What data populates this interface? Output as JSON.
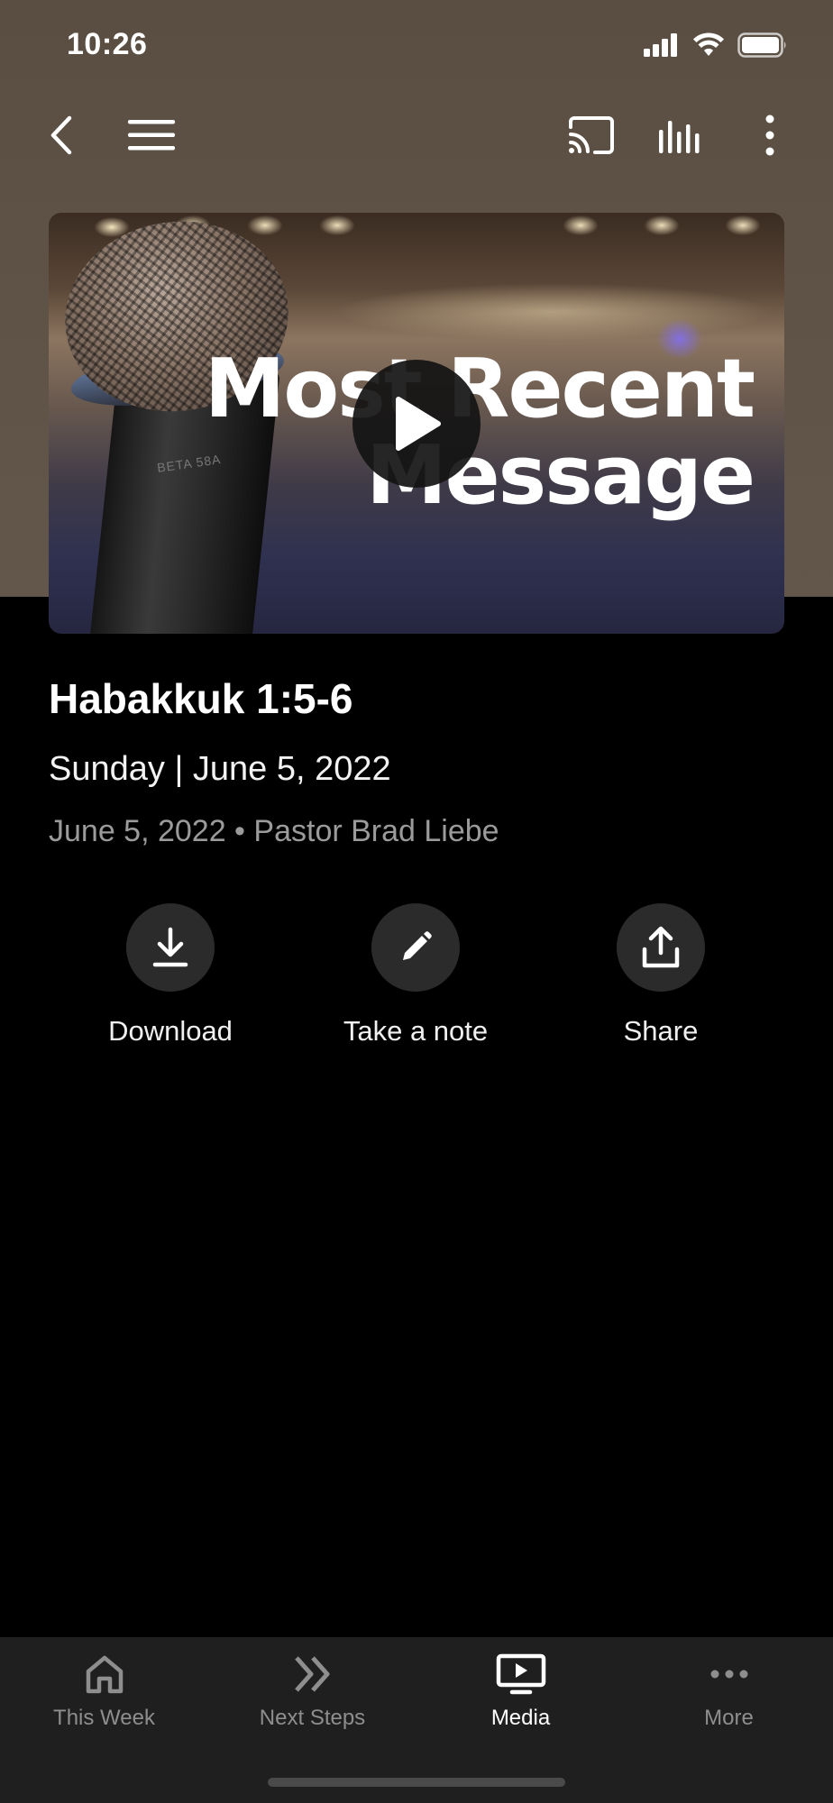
{
  "status_bar": {
    "time": "10:26"
  },
  "hero": {
    "title_line1": "Most Recent",
    "title_line2": "Message",
    "mic_text": "BETA 58A"
  },
  "message": {
    "title": "Habakkuk 1:5-6",
    "subtitle": "Sunday | June 5, 2022",
    "meta": "June 5, 2022 • Pastor Brad Liebe"
  },
  "actions": [
    {
      "label": "Download",
      "icon": "download-icon"
    },
    {
      "label": "Take a note",
      "icon": "pencil-icon"
    },
    {
      "label": "Share",
      "icon": "share-icon"
    }
  ],
  "tabs": [
    {
      "label": "This Week",
      "icon": "home-icon",
      "active": false
    },
    {
      "label": "Next Steps",
      "icon": "double-chevron-icon",
      "active": false
    },
    {
      "label": "Media",
      "icon": "media-play-icon",
      "active": true
    },
    {
      "label": "More",
      "icon": "more-dots-icon",
      "active": false
    }
  ],
  "colors": {
    "header_bg": "#5e5246",
    "page_bg": "#000000",
    "tabbar_bg": "#1f1f1f",
    "action_circle": "#2b2b2b",
    "meta_text": "#9b9b9b",
    "inactive_tab": "#8e8e8e"
  }
}
